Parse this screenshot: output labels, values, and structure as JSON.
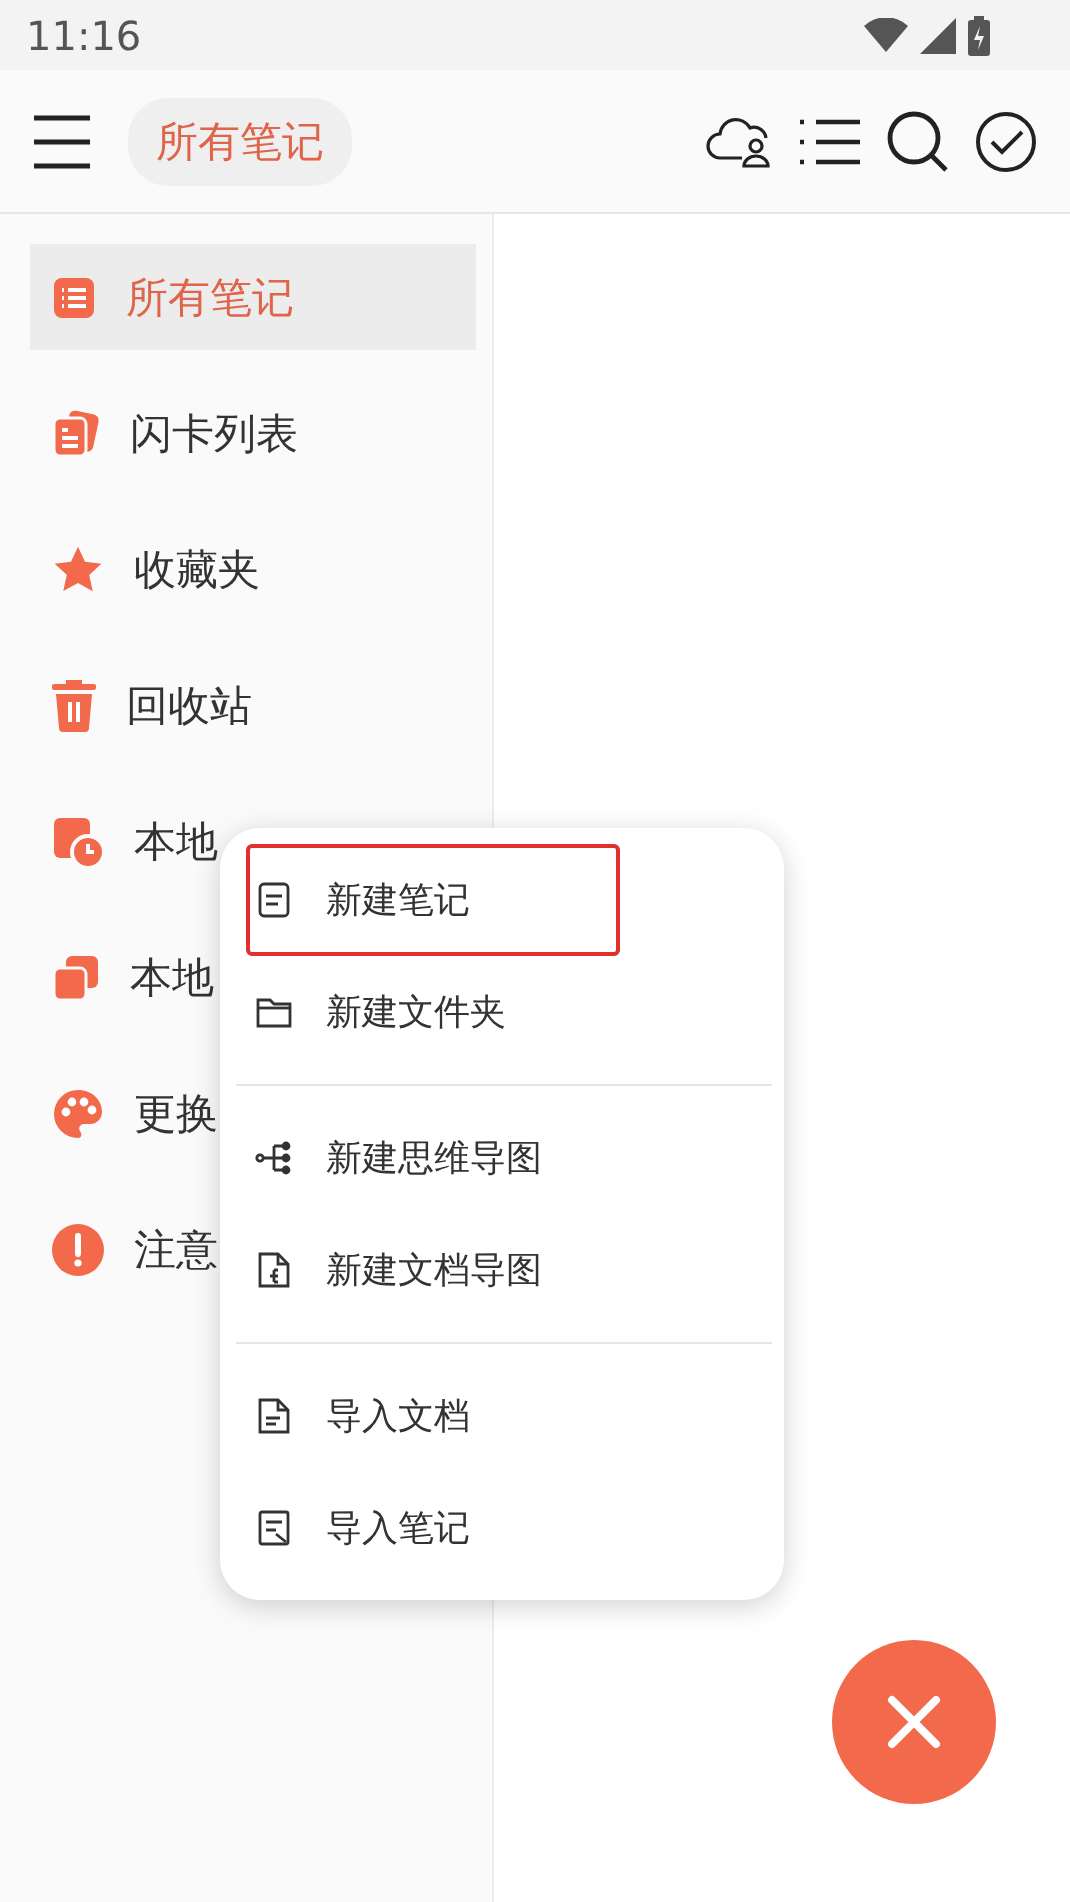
{
  "status_bar": {
    "time": "11:16"
  },
  "toolbar": {
    "title": "所有笔记"
  },
  "sidebar": {
    "items": [
      {
        "kind": "list",
        "label": "所有笔记",
        "selected": true
      },
      {
        "kind": "cards",
        "label": "闪卡列表",
        "selected": false
      },
      {
        "kind": "star",
        "label": "收藏夹",
        "selected": false
      },
      {
        "kind": "trash",
        "label": "回收站",
        "selected": false
      },
      {
        "kind": "history",
        "label": "本地",
        "selected": false
      },
      {
        "kind": "copies",
        "label": "本地",
        "selected": false
      },
      {
        "kind": "palette",
        "label": "更换",
        "selected": false
      },
      {
        "kind": "alert",
        "label": "注意",
        "selected": false
      }
    ]
  },
  "menu": {
    "groups": [
      [
        {
          "kind": "note",
          "label": "新建笔记",
          "highlighted": true
        },
        {
          "kind": "folder",
          "label": "新建文件夹",
          "highlighted": false
        }
      ],
      [
        {
          "kind": "mindmap",
          "label": "新建思维导图",
          "highlighted": false
        },
        {
          "kind": "docmap",
          "label": "新建文档导图",
          "highlighted": false
        }
      ],
      [
        {
          "kind": "import-doc",
          "label": "导入文档",
          "highlighted": false
        },
        {
          "kind": "import-note",
          "label": "导入笔记",
          "highlighted": false
        }
      ]
    ]
  }
}
